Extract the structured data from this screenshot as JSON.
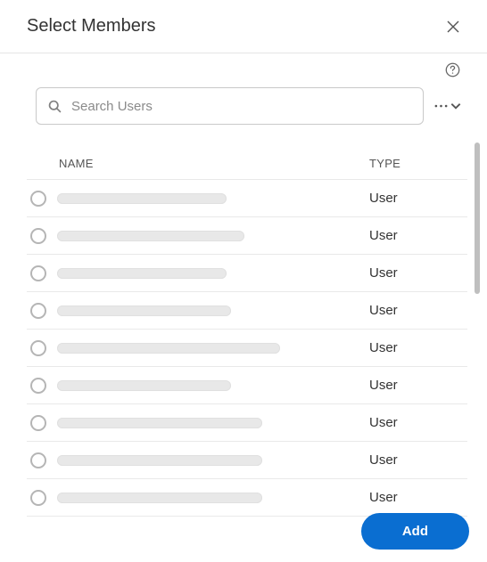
{
  "header": {
    "title": "Select Members"
  },
  "search": {
    "placeholder": "Search Users"
  },
  "columns": {
    "name": "NAME",
    "type": "TYPE"
  },
  "rows": [
    {
      "name_redacted": true,
      "type": "User",
      "name_width": 190
    },
    {
      "name_redacted": true,
      "type": "User",
      "name_width": 210
    },
    {
      "name_redacted": true,
      "type": "User",
      "name_width": 190
    },
    {
      "name_redacted": true,
      "type": "User",
      "name_width": 195
    },
    {
      "name_redacted": true,
      "type": "User",
      "name_width": 250
    },
    {
      "name_redacted": true,
      "type": "User",
      "name_width": 195
    },
    {
      "name_redacted": true,
      "type": "User",
      "name_width": 230
    },
    {
      "name_redacted": true,
      "type": "User",
      "name_width": 230
    },
    {
      "name_redacted": true,
      "type": "User",
      "name_width": 230
    }
  ],
  "footer": {
    "add_label": "Add"
  }
}
